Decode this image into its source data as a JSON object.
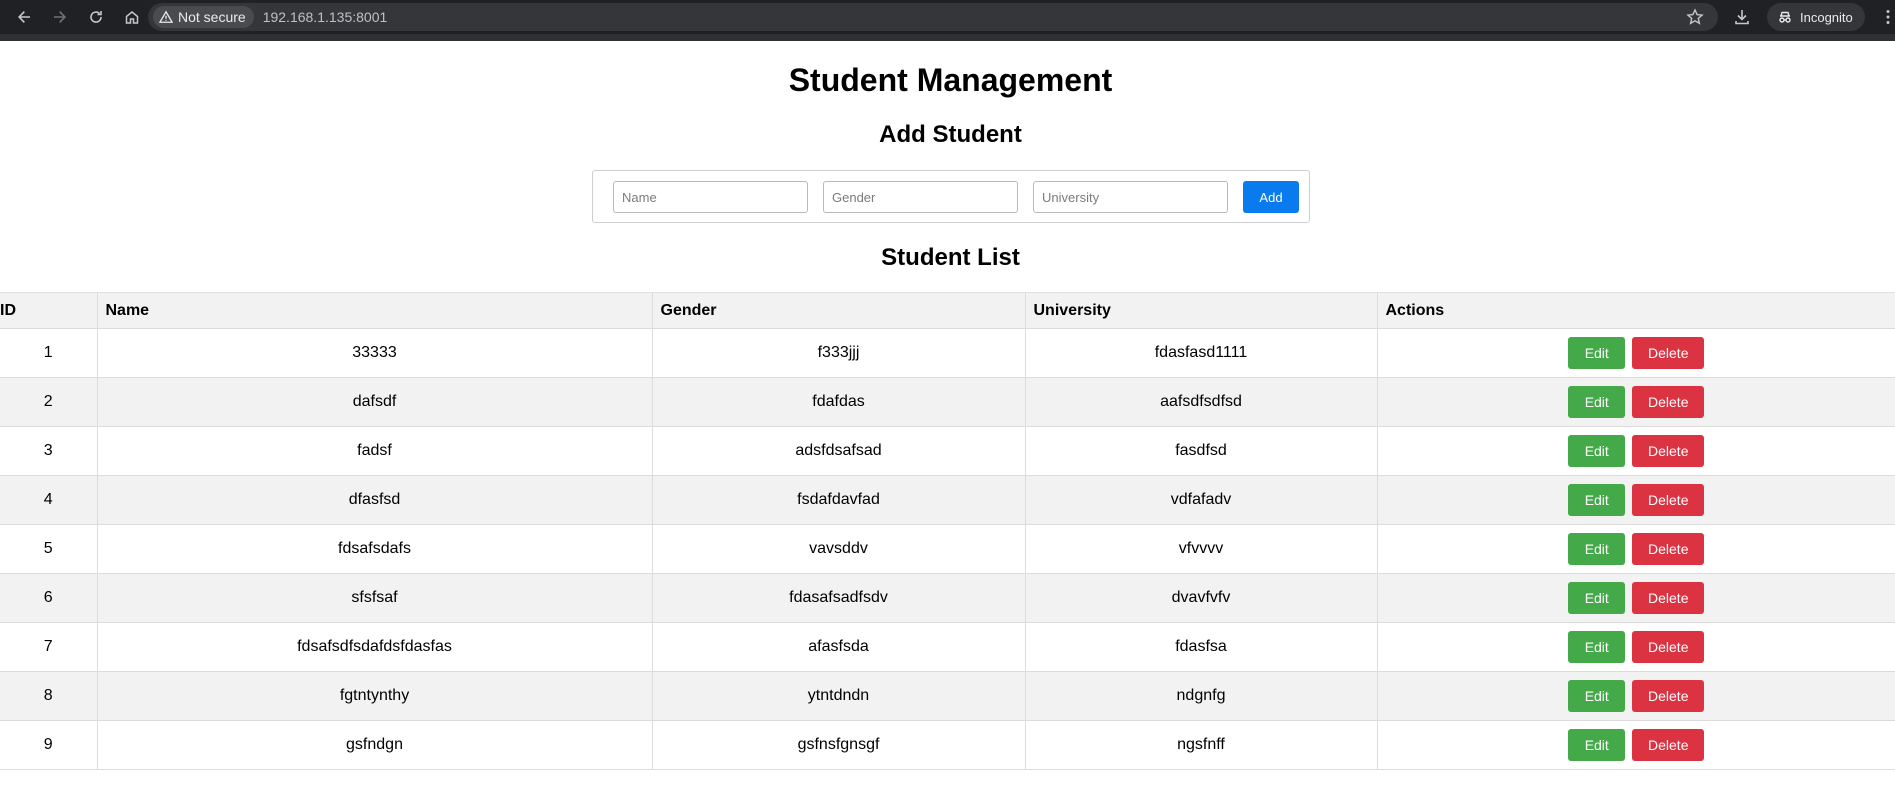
{
  "browser": {
    "security_label": "Not secure",
    "url": "192.168.1.135:8001",
    "profile_label": "Incognito"
  },
  "page": {
    "title": "Student Management",
    "add_section_title": "Add Student",
    "list_section_title": "Student List"
  },
  "form": {
    "name_placeholder": "Name",
    "gender_placeholder": "Gender",
    "university_placeholder": "University",
    "add_label": "Add"
  },
  "table": {
    "headers": [
      "ID",
      "Name",
      "Gender",
      "University",
      "Actions"
    ],
    "edit_label": "Edit",
    "delete_label": "Delete",
    "rows": [
      {
        "id": "1",
        "name": "33333",
        "gender": "f333jjj",
        "university": "fdasfasd1111"
      },
      {
        "id": "2",
        "name": "dafsdf",
        "gender": "fdafdas",
        "university": "aafsdfsdfsd"
      },
      {
        "id": "3",
        "name": "fadsf",
        "gender": "adsfdsafsad",
        "university": "fasdfsd"
      },
      {
        "id": "4",
        "name": "dfasfsd",
        "gender": "fsdafdavfad",
        "university": "vdfafadv"
      },
      {
        "id": "5",
        "name": "fdsafsdafs",
        "gender": "vavsddv",
        "university": "vfvvvv"
      },
      {
        "id": "6",
        "name": "sfsfsaf",
        "gender": "fdasafsadfsdv",
        "university": "dvavfvfv"
      },
      {
        "id": "7",
        "name": "fdsafsdfsdafdsfdasfas",
        "gender": "afasfsda",
        "university": "fdasfsa"
      },
      {
        "id": "8",
        "name": "fgtntynthy",
        "gender": "ytntdndn",
        "university": "ndgnfg"
      },
      {
        "id": "9",
        "name": "gsfndgn",
        "gender": "gsfnsfgnsgf",
        "university": "ngsfnff"
      }
    ]
  },
  "colors": {
    "add_button": "#0a7bef",
    "edit_button": "#44a948",
    "delete_button": "#dc3343"
  }
}
